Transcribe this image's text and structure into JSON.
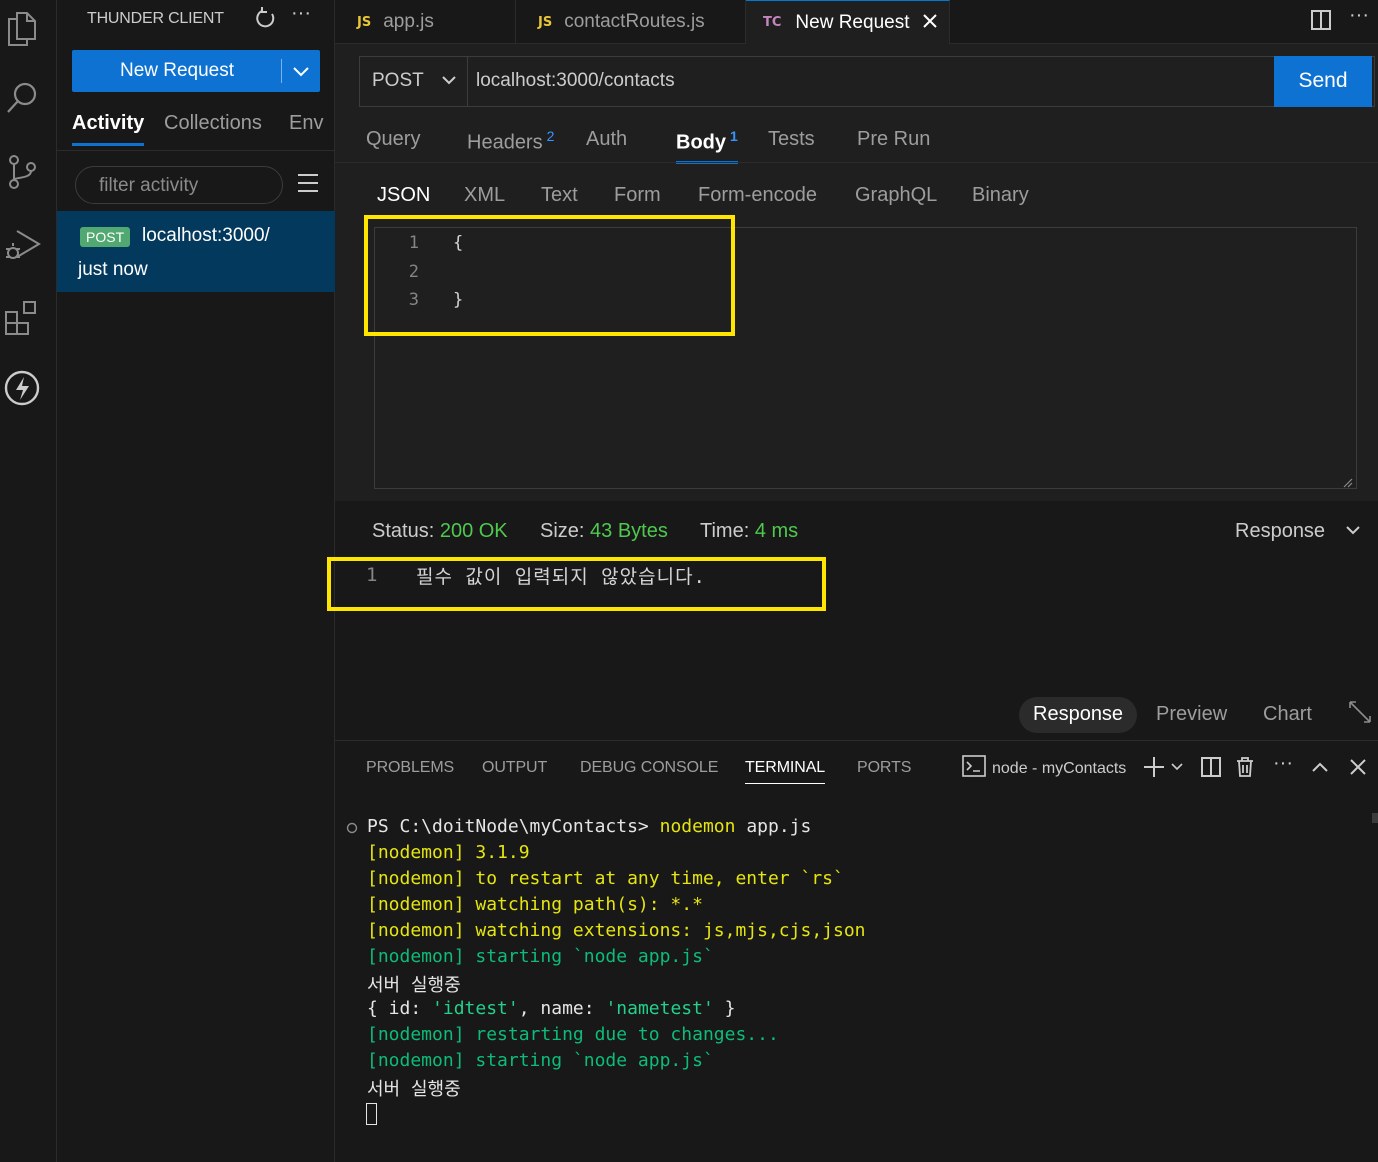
{
  "sidebar": {
    "title": "THUNDER CLIENT",
    "new_request_label": "New Request",
    "tabs": [
      "Activity",
      "Collections",
      "Env"
    ],
    "filter_placeholder": "filter activity",
    "history": [
      {
        "method": "POST",
        "url": "localhost:3000/",
        "time": "just now"
      }
    ]
  },
  "editor_tabs": [
    {
      "icon": "JS",
      "label": "app.js"
    },
    {
      "icon": "JS",
      "label": "contactRoutes.js"
    },
    {
      "icon": "TC",
      "label": "New Request"
    }
  ],
  "request": {
    "method": "POST",
    "url": "localhost:3000/contacts",
    "send_label": "Send",
    "tabs": [
      {
        "label": "Query",
        "count": ""
      },
      {
        "label": "Headers",
        "count": "2"
      },
      {
        "label": "Auth",
        "count": ""
      },
      {
        "label": "Body",
        "count": "1"
      },
      {
        "label": "Tests",
        "count": ""
      },
      {
        "label": "Pre Run",
        "count": ""
      }
    ],
    "body_tabs": [
      "JSON",
      "XML",
      "Text",
      "Form",
      "Form-encode",
      "GraphQL",
      "Binary"
    ],
    "body_lines": [
      {
        "no": "1",
        "code": "{"
      },
      {
        "no": "2",
        "code": ""
      },
      {
        "no": "3",
        "code": "}"
      }
    ]
  },
  "response": {
    "status_label": "Status:",
    "status_value": "200 OK",
    "size_label": "Size:",
    "size_value": "43 Bytes",
    "time_label": "Time:",
    "time_value": "4 ms",
    "view_select": "Response",
    "lines": [
      {
        "no": "1",
        "text": "필수 값이 입력되지 않았습니다."
      }
    ],
    "view_tabs": [
      "Response",
      "Preview",
      "Chart"
    ]
  },
  "panel": {
    "tabs": [
      "PROBLEMS",
      "OUTPUT",
      "DEBUG CONSOLE",
      "TERMINAL",
      "PORTS"
    ],
    "terminal_name": "node - myContacts",
    "terminal": {
      "prompt": "PS C:\\doitNode\\myContacts>",
      "command": "nodemon",
      "command_arg": "app.js",
      "lines": [
        "[nodemon] 3.1.9",
        "[nodemon] to restart at any time, enter `rs`",
        "[nodemon] watching path(s): *.*",
        "[nodemon] watching extensions: js,mjs,cjs,json",
        "[nodemon] starting `node app.js`",
        "서버 실행중",
        "{ id: 'idtest', name: 'nametest' }",
        "[nodemon] restarting due to changes...",
        "[nodemon] starting `node app.js`",
        "서버 실행중"
      ]
    }
  },
  "colors": {
    "accent": "#0e72d3",
    "highlight_box": "#ffe600",
    "status_ok": "#4ec94e",
    "terminal_yellow": "#e5e510",
    "terminal_green": "#0dbc79"
  }
}
